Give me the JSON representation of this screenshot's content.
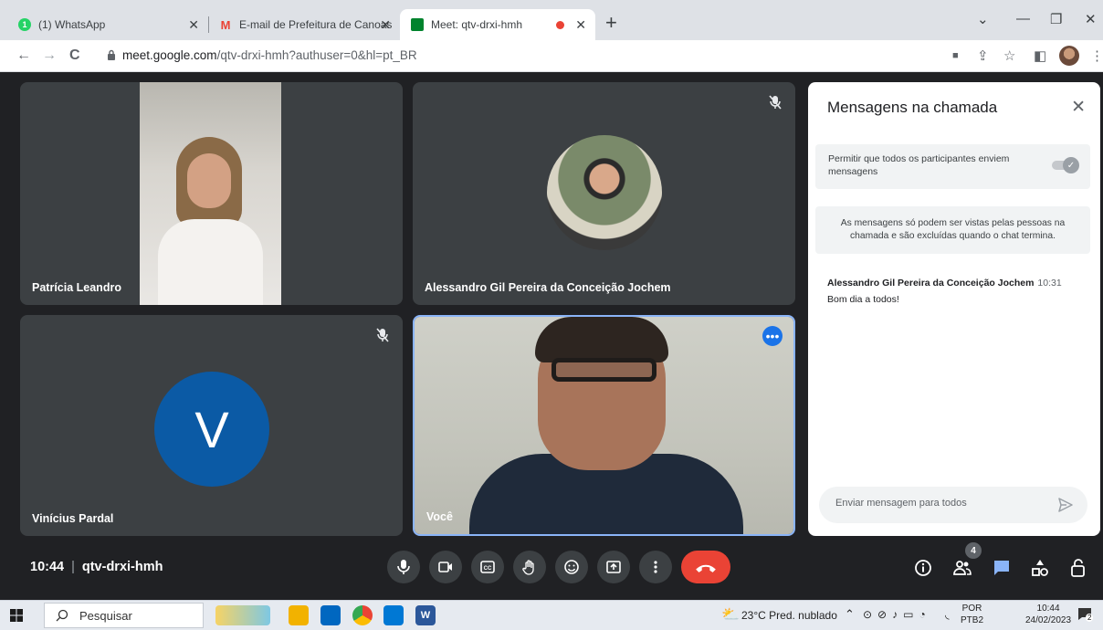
{
  "browser": {
    "tabs": [
      {
        "title": "(1) WhatsApp",
        "favicon": "whatsapp-icon"
      },
      {
        "title": "E-mail de Prefeitura de Canoas",
        "favicon": "gmail-icon"
      },
      {
        "title": "Meet: qtv-drxi-hmh",
        "favicon": "meet-icon"
      }
    ],
    "url_host": "meet.google.com",
    "url_path": "/qtv-drxi-hmh?authuser=0&hl=pt_BR"
  },
  "tiles": [
    {
      "name": "Patrícia Leandro"
    },
    {
      "name": "Alessandro Gil Pereira da Conceição Jochem"
    },
    {
      "name": "Vinícius Pardal",
      "initial": "V"
    },
    {
      "name": "Você"
    }
  ],
  "chat": {
    "title": "Mensagens na chamada",
    "permission_text": "Permitir que todos os participantes enviem mensagens",
    "notice": "As mensagens só podem ser vistas pelas pessoas na chamada e são excluídas quando o chat termina.",
    "messages": [
      {
        "sender": "Alessandro Gil Pereira da Conceição Jochem",
        "time": "10:31",
        "text": "Bom dia a todos!"
      }
    ],
    "input_placeholder": "Enviar mensagem para todos"
  },
  "controls": {
    "time": "10:44",
    "meeting_code": "qtv-drxi-hmh",
    "participants_count": "4"
  },
  "taskbar": {
    "search_placeholder": "Pesquisar",
    "weather": "23°C  Pred. nublado",
    "lang_top": "POR",
    "lang_bottom": "PTB2",
    "clock_time": "10:44",
    "clock_date": "24/02/2023",
    "notif_count": "2"
  },
  "colors": {
    "meet_bg": "#202124",
    "tile_bg": "#3c4043",
    "accent": "#1a73e8",
    "hangup": "#ea4335",
    "avatar_v": "#0b5aa5"
  }
}
